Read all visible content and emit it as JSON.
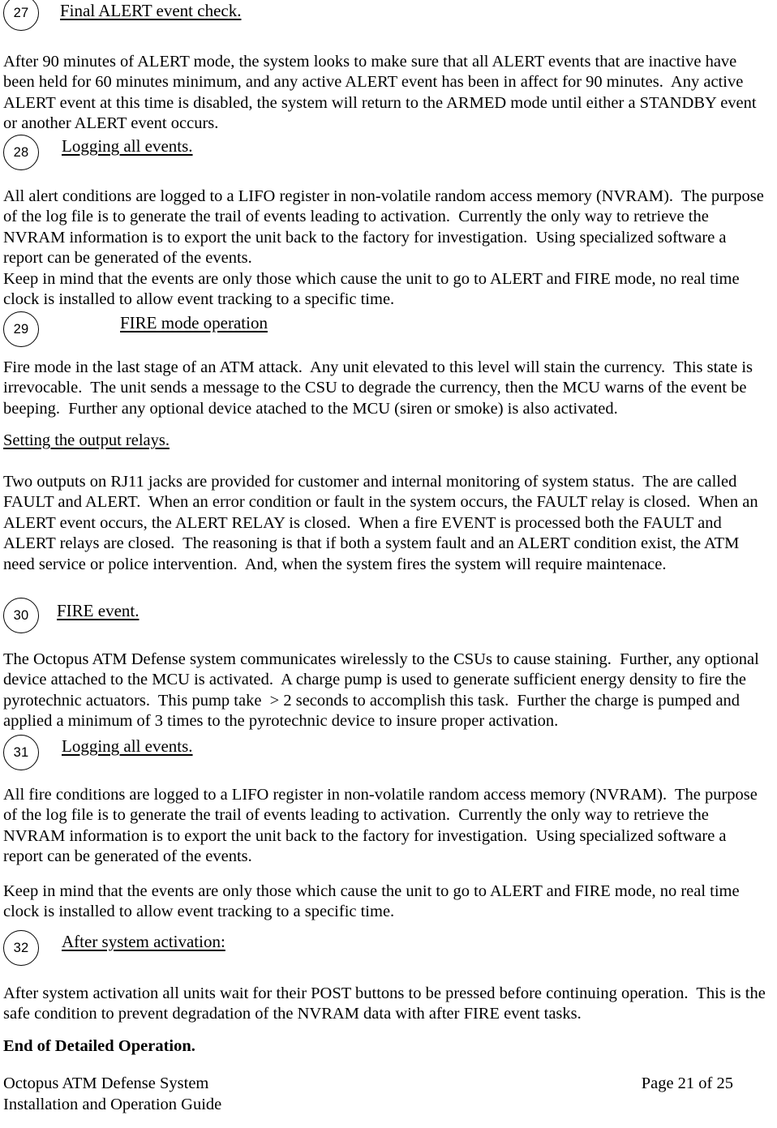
{
  "document": {
    "title": "Octopus ATM Defense System Installation and Operation Guide",
    "page_label": "Page 21 of 25"
  },
  "sections": [
    {
      "number": "27",
      "heading": "Final ALERT event check.",
      "body": "After 90 minutes of ALERT mode, the system looks to make sure that all ALERT events that are inactive have\nbeen held for 60 minutes minimum, and any active ALERT event has been in affect for 90 minutes.  Any active\nALERT event at this time is disabled, the system will return to the ARMED mode until either a STANDBY event\nor another ALERT event occurs."
    },
    {
      "number": "28",
      "heading": "Logging all events.",
      "body": "All alert conditions are logged to a LIFO register in non-volatile random access memory (NVRAM).  The purpose\nof the log file is to generate the trail of events leading to activation.  Currently the only way to retrieve the\nNVRAM information is to export the unit back to the factory for investigation.  Using specialized software a\nreport can be generated of the events.\nKeep in mind that the events are only those which cause the unit to go to ALERT and FIRE mode, no real time\nclock is installed to allow event tracking to a specific time."
    },
    {
      "number": "29",
      "heading": "FIRE mode operation",
      "body": "Fire mode in the last stage of an ATM attack.  Any unit elevated to this level will stain the currency.  This state is\nirrevocable.  The unit sends a message to the CSU to degrade the currency, then the MCU warns of the event be\nbeeping.  Further any optional device atached to the MCU (siren or smoke) is also activated."
    }
  ],
  "subsection_relays": {
    "heading": "Setting the output relays.",
    "body": "Two outputs on RJ11 jacks are provided for customer and internal monitoring of system status.  The are called\nFAULT and ALERT.  When an error condition or fault in the system occurs, the FAULT relay is closed.  When an\nALERT event occurs, the ALERT RELAY is closed.  When a fire EVENT is processed both the FAULT and\nALERT relays are closed.  The reasoning is that if both a system fault and an ALERT condition exist, the ATM\nneed service or police intervention.  And, when the system fires the system will require maintenace."
  },
  "sections2": [
    {
      "number": "30",
      "heading": "FIRE event.",
      "body": "The Octopus ATM Defense system communicates wirelessly to the CSUs to cause staining.  Further, any optional\ndevice attached to the MCU is activated.  A charge pump is used to generate sufficient energy density to fire the\npyrotechnic actuators.  This pump take  > 2 seconds to accomplish this task.  Further the charge is pumped and\napplied a minimum of 3 times to the pyrotechnic device to insure proper activation."
    },
    {
      "number": "31",
      "heading": "Logging all events.",
      "body_1": "All fire conditions are logged to a LIFO register in non-volatile random access memory (NVRAM).  The purpose\nof the log file is to generate the trail of events leading to activation.  Currently the only way to retrieve the\nNVRAM information is to export the unit back to the factory for investigation.  Using specialized software a\nreport can be generated of the events.",
      "body_2": "Keep in mind that the events are only those which cause the unit to go to ALERT and FIRE mode, no real time\nclock is installed to allow event tracking to a specific time."
    },
    {
      "number": "32",
      "heading": "After system activation:",
      "body": "After system activation all units wait for their POST buttons to be pressed before continuing operation.  This is the\nsafe condition to prevent degradation of the NVRAM data with after FIRE event tasks."
    }
  ],
  "closing": {
    "text": "End of Detailed Operation."
  },
  "footer": {
    "line1": "Octopus ATM Defense System",
    "line2": "Installation and Operation Guide",
    "page": "Page 21 of 25"
  }
}
